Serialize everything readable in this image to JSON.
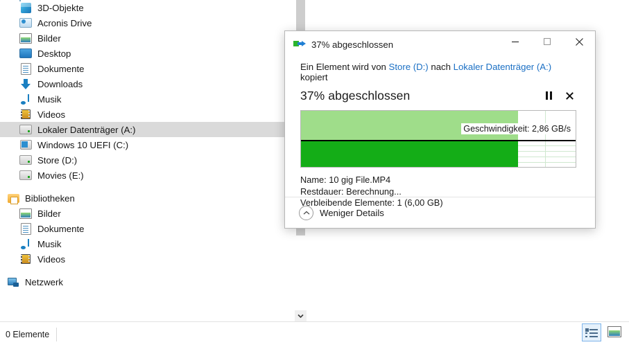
{
  "explorer": {
    "nav_items": [
      {
        "label": "3D-Objekte",
        "icon": "cube-icon",
        "level": 2,
        "selected": false
      },
      {
        "label": "Acronis Drive",
        "icon": "drive-blue-icon",
        "level": 2,
        "selected": false
      },
      {
        "label": "Bilder",
        "icon": "pictures-icon",
        "level": 2,
        "selected": false
      },
      {
        "label": "Desktop",
        "icon": "desktop-icon",
        "level": 2,
        "selected": false
      },
      {
        "label": "Dokumente",
        "icon": "documents-icon",
        "level": 2,
        "selected": false
      },
      {
        "label": "Downloads",
        "icon": "downloads-icon",
        "level": 2,
        "selected": false
      },
      {
        "label": "Musik",
        "icon": "music-icon",
        "level": 2,
        "selected": false
      },
      {
        "label": "Videos",
        "icon": "videos-icon",
        "level": 2,
        "selected": false
      },
      {
        "label": "Lokaler Datenträger (A:)",
        "icon": "drive-icon",
        "level": 2,
        "selected": true
      },
      {
        "label": "Windows 10 UEFI (C:)",
        "icon": "windows-drive-icon",
        "level": 2,
        "selected": false
      },
      {
        "label": "Store (D:)",
        "icon": "drive-icon",
        "level": 2,
        "selected": false
      },
      {
        "label": "Movies (E:)",
        "icon": "drive-icon",
        "level": 2,
        "selected": false
      }
    ],
    "libraries_group": {
      "label": "Bibliotheken",
      "icon": "library-icon"
    },
    "library_items": [
      {
        "label": "Bilder",
        "icon": "pictures-icon"
      },
      {
        "label": "Dokumente",
        "icon": "documents-icon"
      },
      {
        "label": "Musik",
        "icon": "music-icon"
      },
      {
        "label": "Videos",
        "icon": "videos-icon"
      }
    ],
    "network_group": {
      "label": "Netzwerk",
      "icon": "network-icon"
    },
    "statusbar": {
      "item_count": "0 Elemente"
    },
    "view_buttons": [
      {
        "name": "details-view-button",
        "icon": "details-view-icon",
        "active": true
      },
      {
        "name": "thumbnail-view-button",
        "icon": "large-icons-view-icon",
        "active": false
      }
    ],
    "scrollbars": {
      "vertical_down_arrow": "⌄",
      "horizontal_left_arrow": "‹",
      "horizontal_right_arrow": "›"
    }
  },
  "dialog": {
    "title": "37% abgeschlossen",
    "title_icon": "copy-icon",
    "window_controls": {
      "minimize": "minimize-icon",
      "maximize": "maximize-icon",
      "close": "close-icon"
    },
    "description": {
      "prefix": "Ein Element wird von ",
      "source": "Store (D:)",
      "middle": " nach ",
      "destination": "Lokaler Datenträger (A:)",
      "suffix": " kopiert"
    },
    "progress_text": "37% abgeschlossen",
    "progress_percent": 37,
    "pause_button": "pause-icon",
    "cancel_button": "cancel-icon",
    "speed_label": "Geschwindigkeit: 2,86 GB/s",
    "details": {
      "name": "Name:  10 gig File.MP4",
      "remaining_time": "Restdauer:  Berechnung...",
      "remaining_items": "Verbleibende Elemente:  1 (6,00 GB)"
    },
    "footer": {
      "label": "Weniger Details",
      "icon": "chevron-up-icon"
    },
    "graph": {
      "fill_light": "#9fdd8a",
      "fill_dark": "#14ad17",
      "grid_color": "#cfe8cf",
      "axis_color": "#000000"
    }
  }
}
